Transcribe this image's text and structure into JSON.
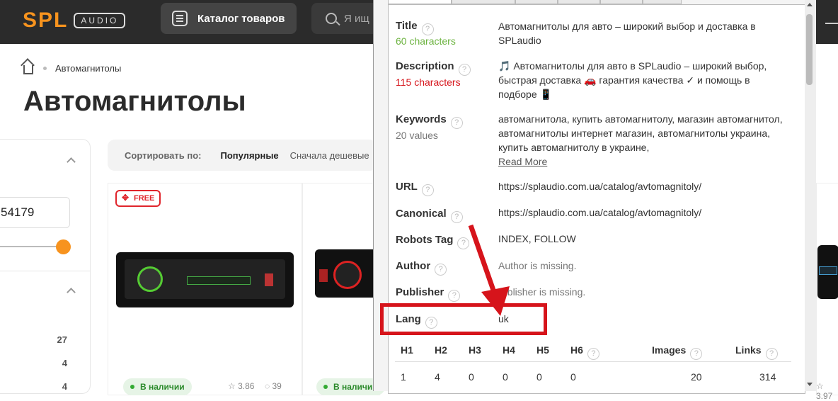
{
  "header": {
    "logo_text": "SPL",
    "logo_sub": "AUDIO",
    "catalog_button": "Каталог товаров",
    "search_placeholder": "Я ищ"
  },
  "breadcrumb": {
    "current": "Автомагнитолы"
  },
  "page_title": "Автомагнитолы",
  "filter": {
    "price_value": "54179",
    "counts": [
      "27",
      "4",
      "4"
    ]
  },
  "sort": {
    "label": "Сортировать по:",
    "active": "Популярные",
    "option2": "Сначала дешевые"
  },
  "products": [
    {
      "badge": "FREE",
      "stock": "В наличии",
      "rating": "3.86",
      "reviews": "39"
    },
    {
      "stock": "В наличии"
    },
    {
      "rating": "3.97"
    }
  ],
  "seo": {
    "title_label": "Title",
    "title_count": "60 characters",
    "title_value": "Автомагнитолы для авто – широкий выбор и доставка в SPLaudio",
    "description_label": "Description",
    "description_count": "115 characters",
    "description_value": "🎵 Автомагнитолы для авто в SPLaudio – широкий выбор, быстрая доставка 🚗 гарантия качества ✓ и помощь в подборе 📱",
    "keywords_label": "Keywords",
    "keywords_count": "20 values",
    "keywords_value": "автомагнитола, купить автомагнитолу, магазин автомагнитол, автомагнитолы интернет магазин, автомагнитолы украина, купить автомагнитолу в украине,",
    "read_more": "Read More",
    "url_label": "URL",
    "url_value": "https://splaudio.com.ua/catalog/avtomagnitoly/",
    "canonical_label": "Canonical",
    "canonical_value": "https://splaudio.com.ua/catalog/avtomagnitoly/",
    "robots_label": "Robots Tag",
    "robots_value": "INDEX, FOLLOW",
    "author_label": "Author",
    "author_value": "Author is missing.",
    "publisher_label": "Publisher",
    "publisher_value": "ublisher is missing.",
    "lang_label": "Lang",
    "lang_value": "uk",
    "help_glyph": "?",
    "headings": {
      "labels": [
        "H1",
        "H2",
        "H3",
        "H4",
        "H5",
        "H6"
      ],
      "values": [
        "1",
        "4",
        "0",
        "0",
        "0",
        "0"
      ],
      "images_label": "Images",
      "images_value": "20",
      "links_label": "Links",
      "links_value": "314"
    }
  },
  "colors": {
    "accent": "#f7931e",
    "ok": "#4caf50",
    "error": "#d6141b",
    "annotation": "#d6141b"
  }
}
